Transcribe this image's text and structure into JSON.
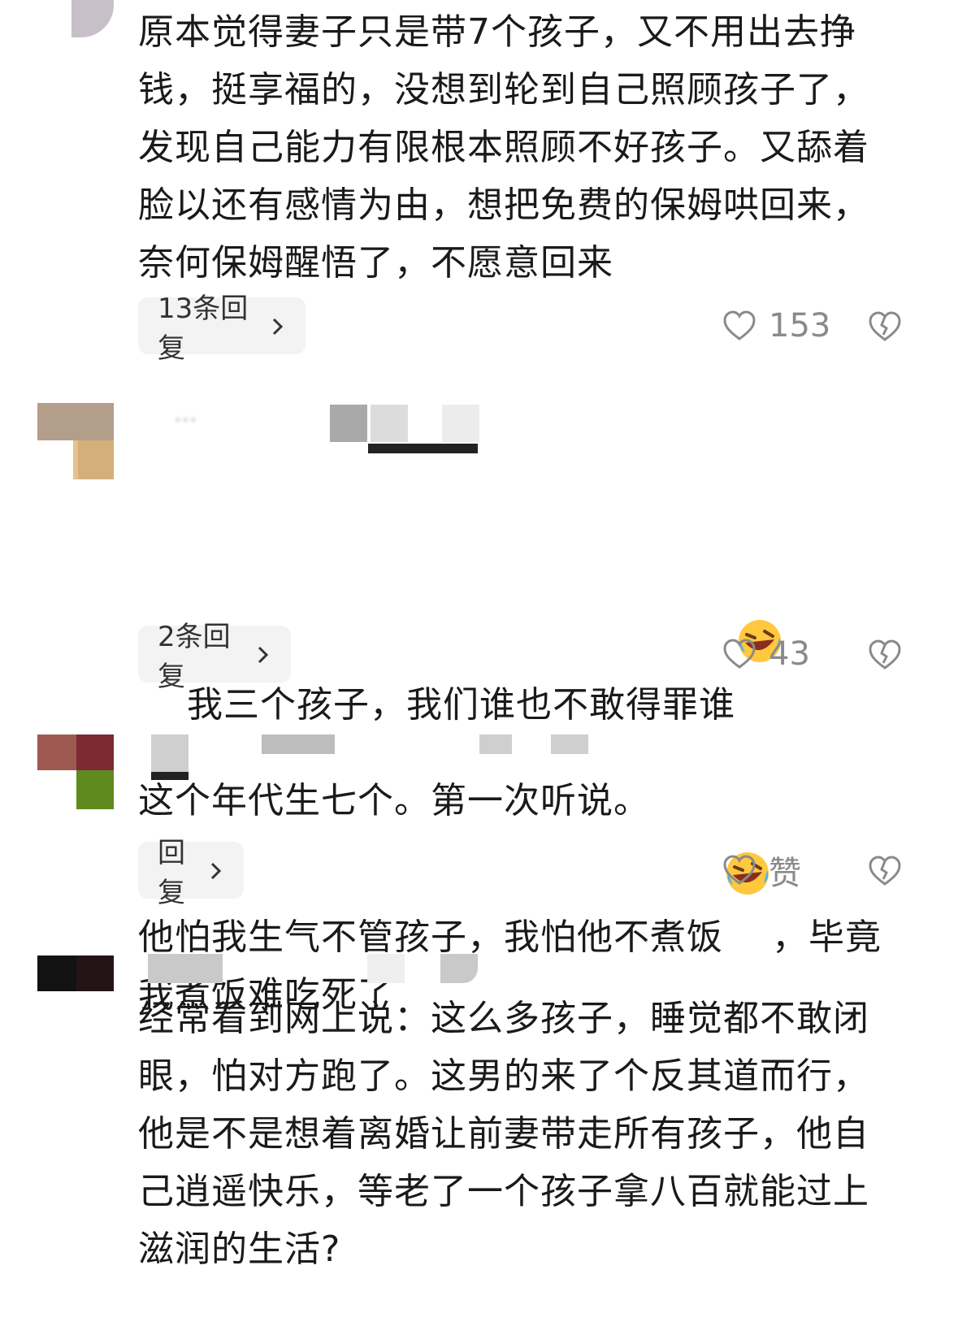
{
  "comments": [
    {
      "text": "原本觉得妻子只是带7个孩子，又不用出去挣钱，挺享福的，没想到轮到自己照顾孩子了，发现自己能力有限根本照顾不好孩子。又舔着脸以还有感情为由，想把免费的保姆哄回来，奈何保姆醒悟了，不愿意回来",
      "reply_label": "13条回复",
      "like_count": "153"
    },
    {
      "text_part1": "我三个孩子，我们谁也不敢得罪谁",
      "text_part2": "他怕我生气不管孩子，我怕他不煮饭",
      "text_part3": "，毕竟我煮饭难吃死了",
      "reply_label": "2条回复",
      "like_count": "43"
    },
    {
      "text": "这个年代生七个。第一次听说。",
      "reply_label": "回复",
      "like_count": "赞"
    },
    {
      "text": "经常看到网上说：这么多孩子，睡觉都不敢闭眼，怕对方跑了。这男的来了个反其道而行，他是不是想着离婚让前妻带走所有孩子，他自己逍遥快乐，等老了一个孩子拿八百就能过上滋润的生活?"
    }
  ],
  "colors": {
    "text": "#1a1a1a",
    "muted": "#8a8a8a",
    "reply_bg": "#f3f3f3"
  }
}
